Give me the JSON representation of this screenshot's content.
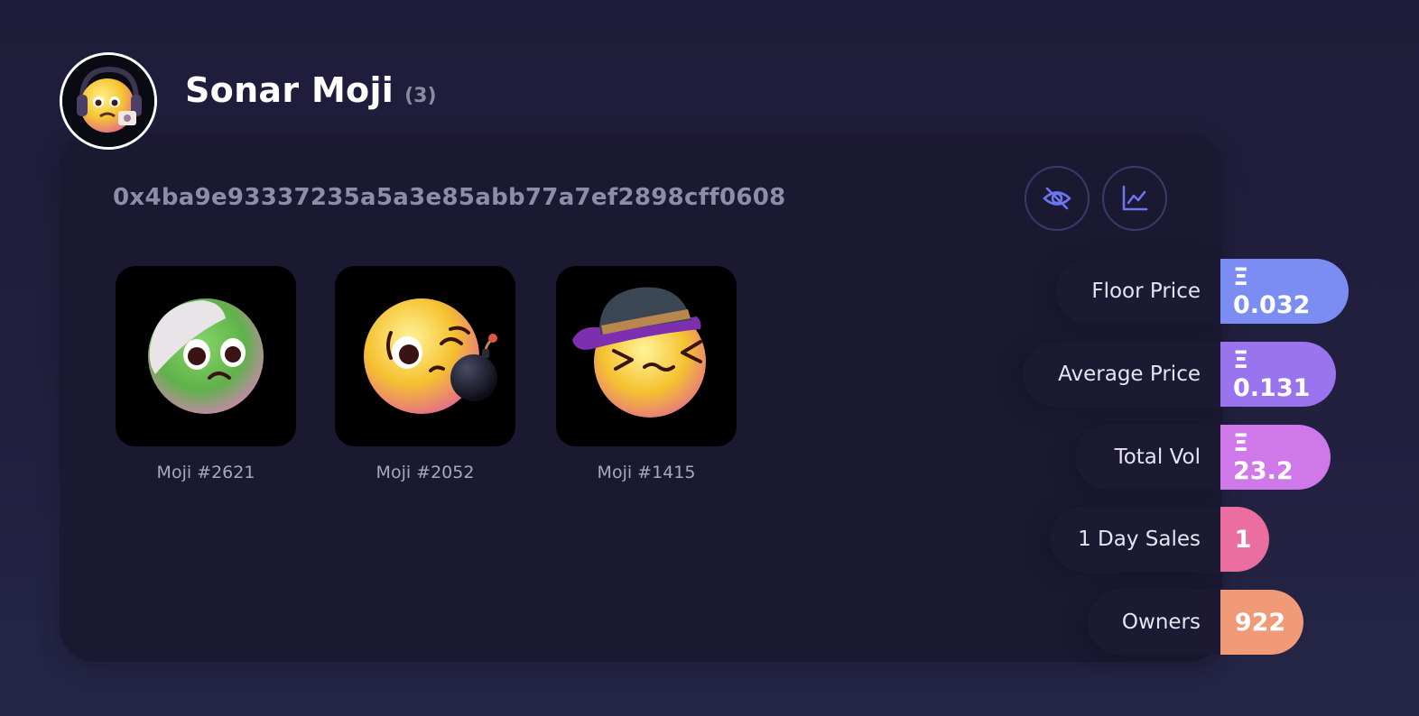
{
  "collection": {
    "name": "Sonar Moji",
    "count": "(3)",
    "address": "0x4ba9e93337235a5a3e85abb77a7ef2898cff0608"
  },
  "actions": {
    "hide_icon": "eye-off-icon",
    "chart_icon": "line-chart-icon"
  },
  "nfts": [
    {
      "label": "Moji #2621",
      "face": "green-bandaged"
    },
    {
      "label": "Moji #2052",
      "face": "bomb-wink"
    },
    {
      "label": "Moji #1415",
      "face": "fedora-squint"
    }
  ],
  "stats": [
    {
      "label": "Floor Price",
      "value": "Ξ 0.032",
      "color": "#7b8cf2"
    },
    {
      "label": "Average Price",
      "value": "Ξ 0.131",
      "color": "#9a74ef"
    },
    {
      "label": "Total Vol",
      "value": "Ξ 23.2",
      "color": "#cf78ea"
    },
    {
      "label": "1 Day Sales",
      "value": "1",
      "color": "#ea6e9f"
    },
    {
      "label": "Owners",
      "value": "922",
      "color": "#f09a78"
    }
  ]
}
